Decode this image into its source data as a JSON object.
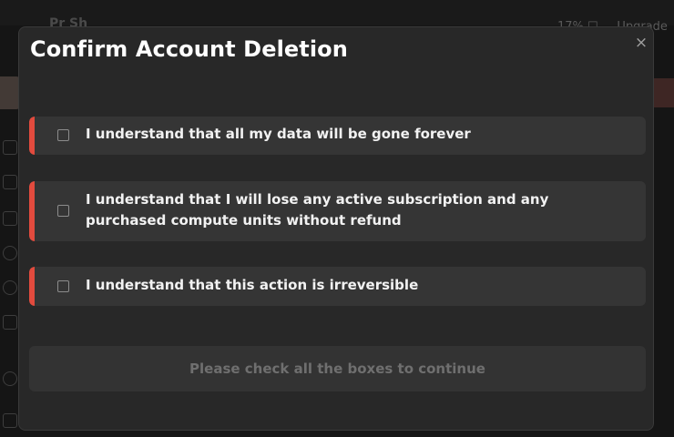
{
  "background": {
    "header_title": "Pr Sh",
    "header_right": "17% ☐ ... Upgrade"
  },
  "modal": {
    "title": "Confirm Account Deletion",
    "close_icon": "×",
    "checkboxes": [
      {
        "label": "I understand that all my data will be gone forever",
        "checked": false
      },
      {
        "label": "I understand that I will lose any active subscription and any purchased compute units without refund",
        "checked": false
      },
      {
        "label": "I understand that this action is irreversible",
        "checked": false
      }
    ],
    "continue_button": {
      "label": "Please check all the boxes to continue",
      "disabled": true
    }
  },
  "colors": {
    "accent": "#e24b3e",
    "modal_bg": "#282828",
    "row_bg": "#353535",
    "title_text": "#ffffff",
    "disabled_text": "#6f6f6f"
  }
}
